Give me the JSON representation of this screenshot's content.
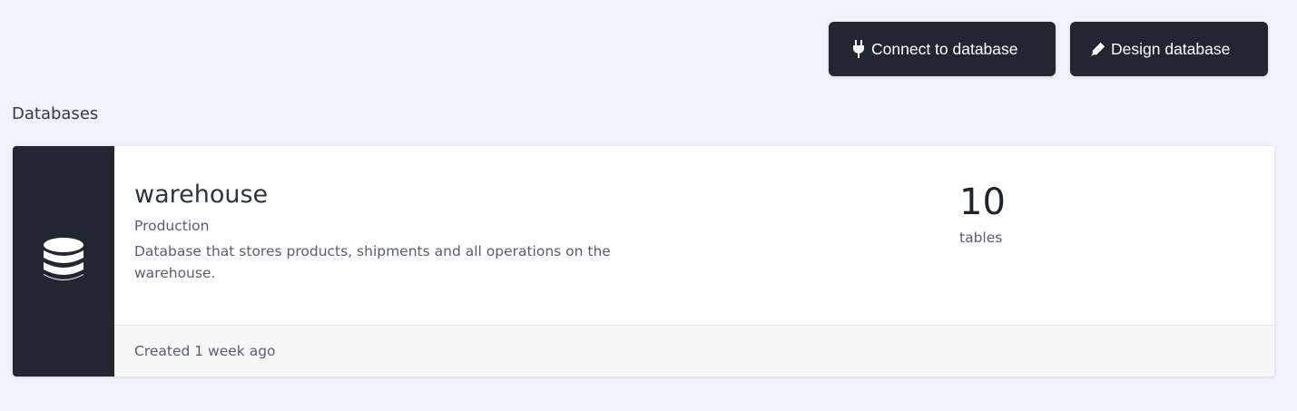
{
  "toolbar": {
    "connect_label": "Connect to database",
    "connect_icon": "plug-icon",
    "design_label": "Design database",
    "design_icon": "pen-icon"
  },
  "section": {
    "title": "Databases"
  },
  "databases": [
    {
      "name": "warehouse",
      "environment": "Production",
      "description": "Database that stores products, shipments and all operations on the warehouse.",
      "table_count": "10",
      "table_label": "tables",
      "created": "Created 1 week ago",
      "icon": "database-icon"
    }
  ],
  "colors": {
    "background": "#f0f3fb",
    "dark": "#212630",
    "card": "#ffffff",
    "footer": "#f7f7f7"
  }
}
